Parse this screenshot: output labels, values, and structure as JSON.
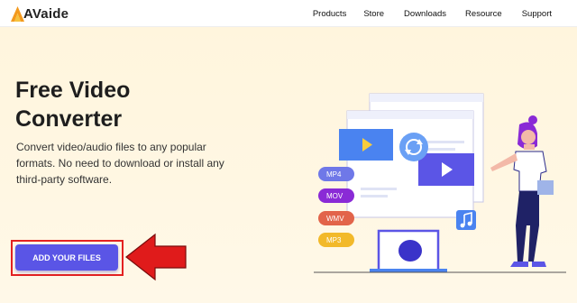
{
  "brand": {
    "logo_text": "AVaide"
  },
  "nav": {
    "items": [
      {
        "label": "Products"
      },
      {
        "label": "Store"
      },
      {
        "label": "Downloads"
      },
      {
        "label": "Resource"
      },
      {
        "label": "Support"
      }
    ]
  },
  "hero": {
    "title_line1": "Free Video",
    "title_line2": "Converter",
    "description": "Convert video/audio files to any popular formats. No need to download or install any third-party software.",
    "button_label": "ADD YOUR FILES"
  },
  "illustration": {
    "formats": [
      {
        "label": "MP4",
        "color": "#6f78e8"
      },
      {
        "label": "MOV",
        "color": "#8a2ad6"
      },
      {
        "label": "WMV",
        "color": "#e2644a"
      },
      {
        "label": "MP3",
        "color": "#f2b92a"
      }
    ]
  },
  "colors": {
    "accent": "#5a55e6",
    "highlight": "#e32121",
    "hero_bg": "#fff5dd"
  }
}
